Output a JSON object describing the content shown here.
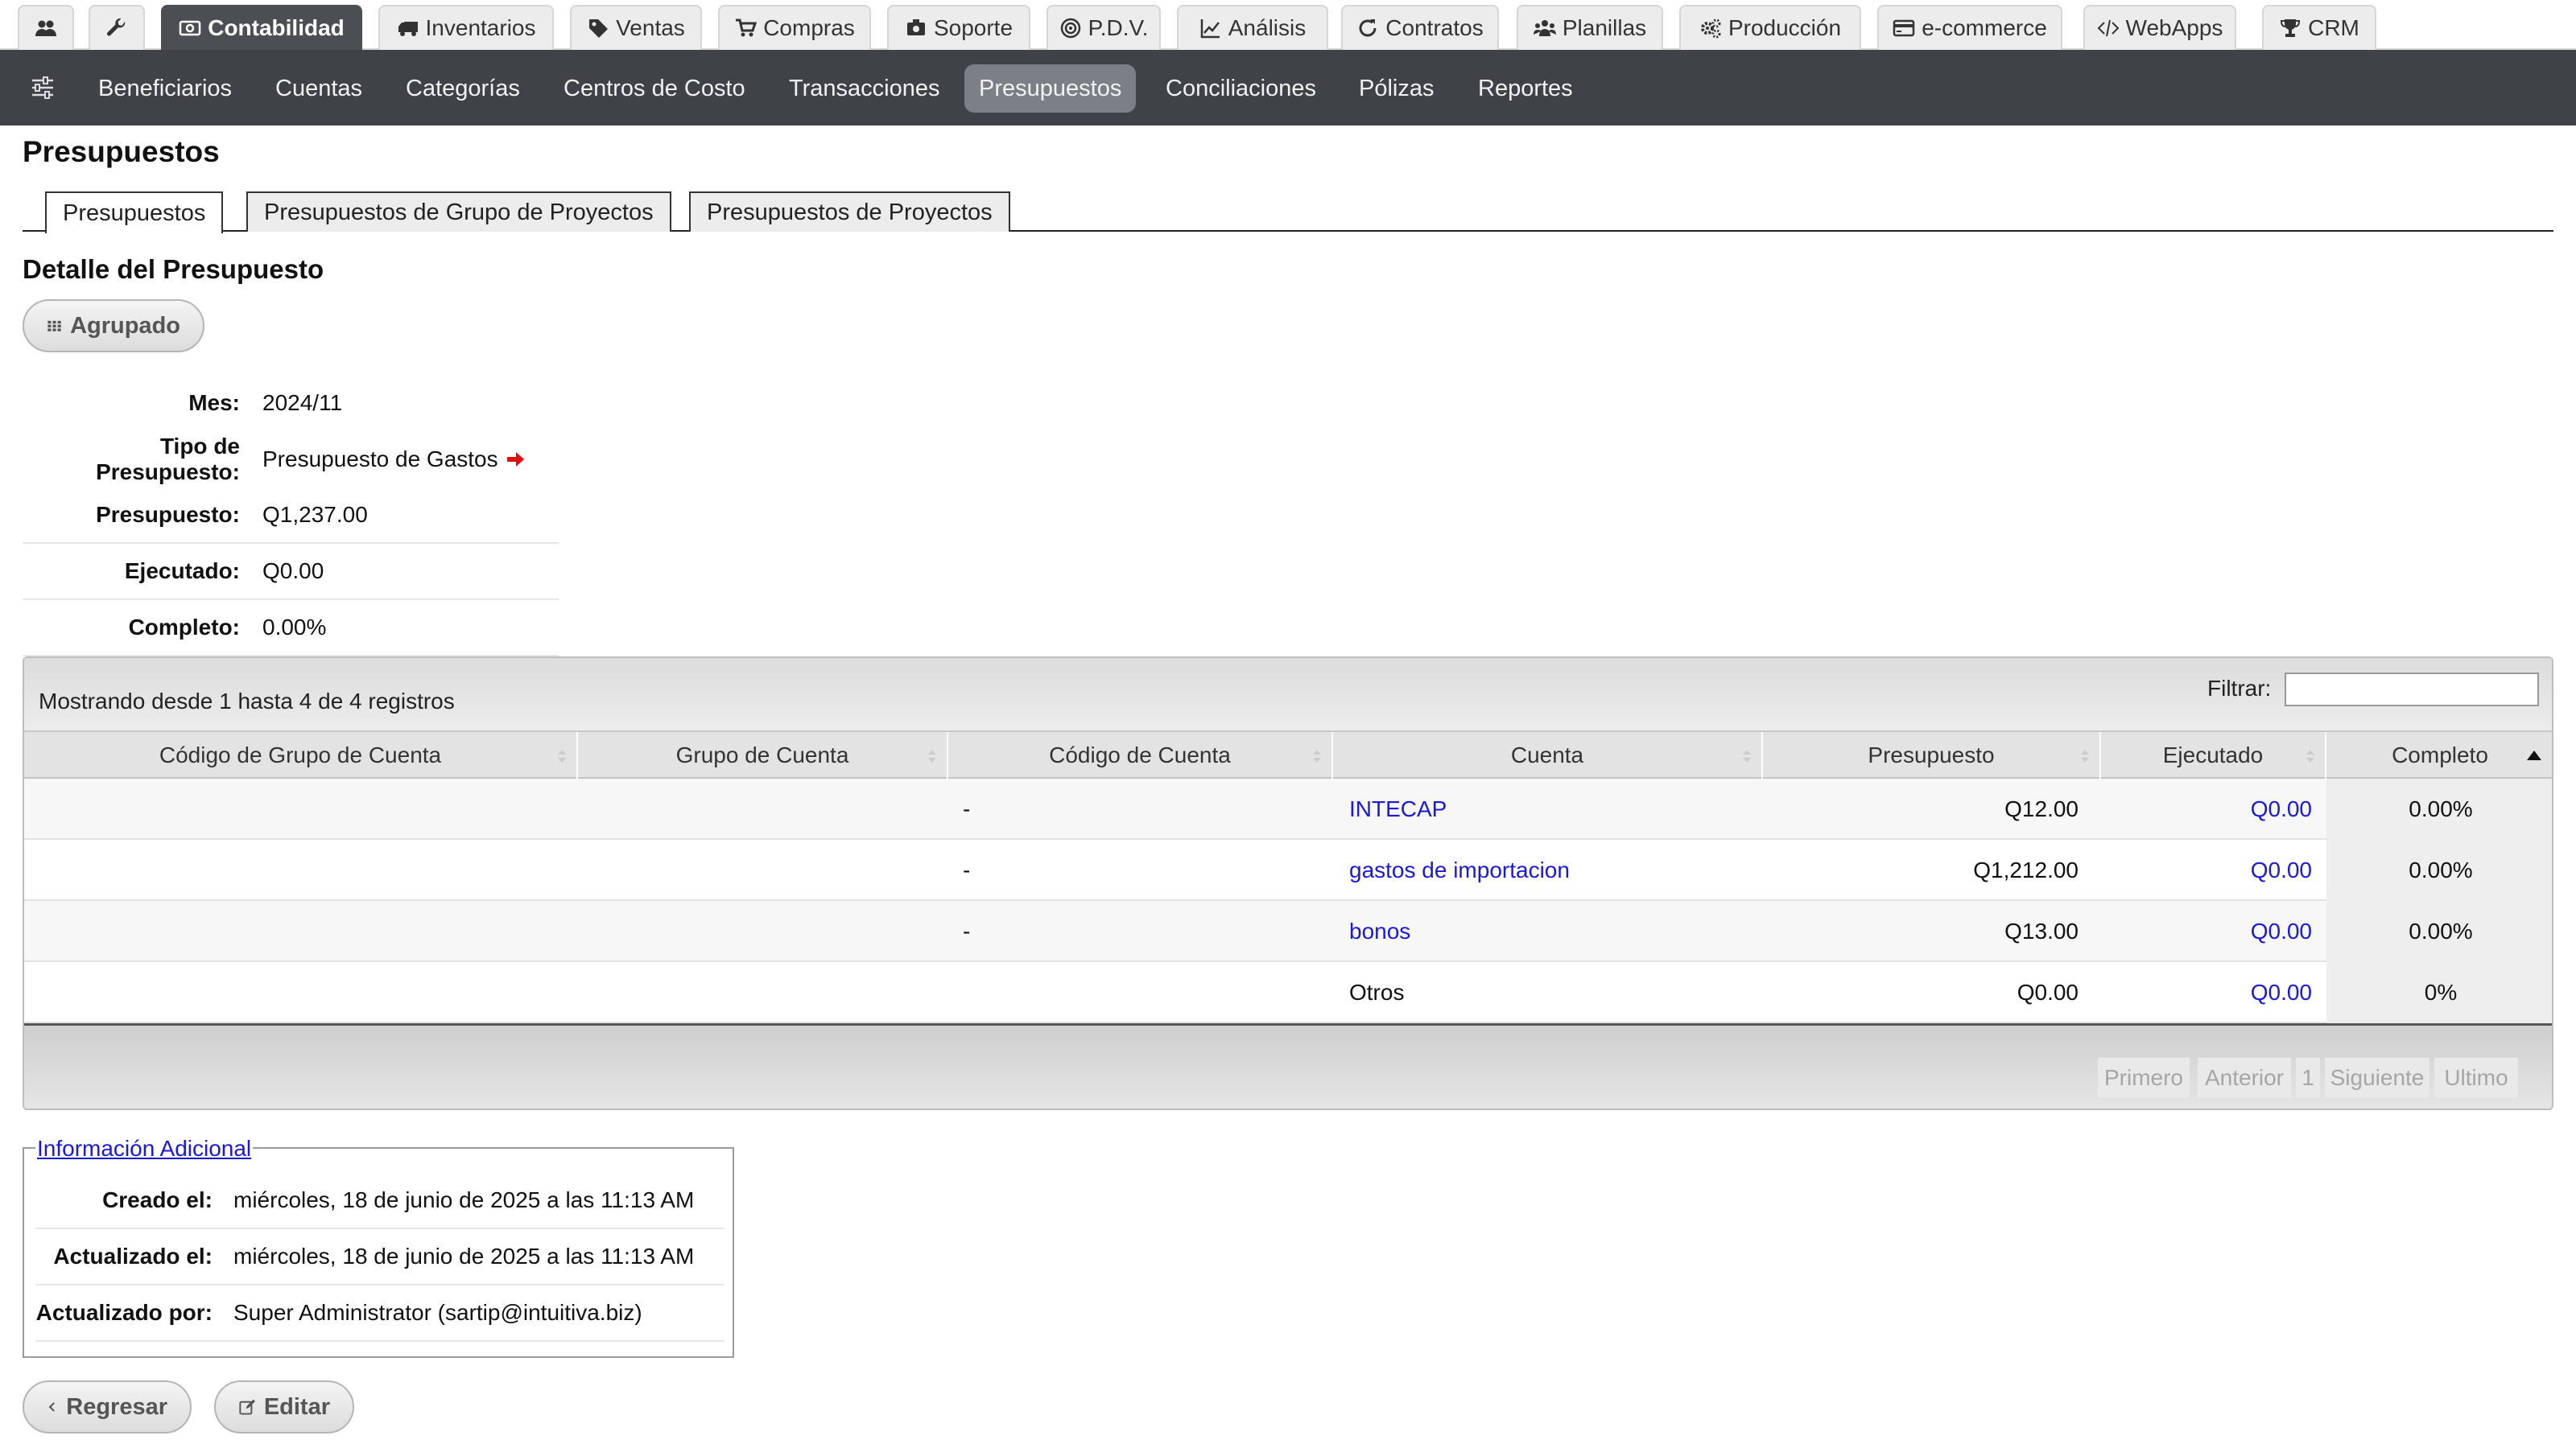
{
  "modules": [
    {
      "label": "",
      "icon": "users-icon"
    },
    {
      "label": "",
      "icon": "wrench-icon"
    },
    {
      "label": "Contabilidad",
      "icon": "money-icon"
    },
    {
      "label": "Inventarios",
      "icon": "truck-icon"
    },
    {
      "label": "Ventas",
      "icon": "tag-icon"
    },
    {
      "label": "Compras",
      "icon": "cart-icon"
    },
    {
      "label": "Soporte",
      "icon": "support-icon"
    },
    {
      "label": "P.D.V.",
      "icon": "pos-icon"
    },
    {
      "label": "Análisis",
      "icon": "chart-icon"
    },
    {
      "label": "Contratos",
      "icon": "refresh-icon"
    },
    {
      "label": "Planillas",
      "icon": "group-icon"
    },
    {
      "label": "Producción",
      "icon": "cogs-icon"
    },
    {
      "label": "e-commerce",
      "icon": "credit-card-icon"
    },
    {
      "label": "WebApps",
      "icon": "code-icon"
    },
    {
      "label": "CRM",
      "icon": "trophy-icon"
    }
  ],
  "subnav": [
    "Beneficiarios",
    "Cuentas",
    "Categorías",
    "Centros de Costo",
    "Transacciones",
    "Presupuestos",
    "Conciliaciones",
    "Pólizas",
    "Reportes"
  ],
  "page_title": "Presupuestos",
  "tabs": [
    "Presupuestos",
    "Presupuestos de Grupo de Proyectos",
    "Presupuestos de Proyectos"
  ],
  "section_title": "Detalle del Presupuesto",
  "grouped_button": "Agrupado",
  "details": {
    "mes_label": "Mes:",
    "mes": "2024/11",
    "tipo_label": "Tipo de Presupuesto:",
    "tipo": "Presupuesto de Gastos",
    "presupuesto_label": "Presupuesto:",
    "presupuesto": "Q1,237.00",
    "ejecutado_label": "Ejecutado:",
    "ejecutado": "Q0.00",
    "completo_label": "Completo:",
    "completo": "0.00%"
  },
  "table": {
    "info": "Mostrando desde 1 hasta 4 de 4 registros",
    "filter_label": "Filtrar:",
    "filter_value": "",
    "columns": [
      "Código de Grupo de Cuenta",
      "Grupo de Cuenta",
      "Código de Cuenta",
      "Cuenta",
      "Presupuesto",
      "Ejecutado",
      "Completo"
    ],
    "rows": [
      {
        "codigo_grupo": "",
        "grupo": "",
        "codigo": "-",
        "cuenta": "INTECAP",
        "presupuesto": "Q12.00",
        "ejecutado": "Q0.00",
        "completo": "0.00%"
      },
      {
        "codigo_grupo": "",
        "grupo": "",
        "codigo": "-",
        "cuenta": "gastos de importacion",
        "presupuesto": "Q1,212.00",
        "ejecutado": "Q0.00",
        "completo": "0.00%"
      },
      {
        "codigo_grupo": "",
        "grupo": "",
        "codigo": "-",
        "cuenta": "bonos",
        "presupuesto": "Q13.00",
        "ejecutado": "Q0.00",
        "completo": "0.00%"
      },
      {
        "codigo_grupo": "",
        "grupo": "",
        "codigo": "",
        "cuenta": "Otros",
        "presupuesto": "Q0.00",
        "ejecutado": "Q0.00",
        "completo": "0%"
      }
    ],
    "pagination": {
      "first": "Primero",
      "prev": "Anterior",
      "page": "1",
      "next": "Siguiente",
      "last": "Ultimo"
    }
  },
  "additional": {
    "title": "Información Adicional",
    "creado_label": "Creado el:",
    "creado": "miércoles, 18 de junio de 2025 a las 11:13 AM",
    "actualizado_label": "Actualizado el:",
    "actualizado": "miércoles, 18 de junio de 2025 a las 11:13 AM",
    "por_label": "Actualizado por:",
    "por": "Super Administrator (sartip@intuitiva.biz)"
  },
  "actions": {
    "back": "Regresar",
    "edit": "Editar"
  },
  "colors": {
    "link": "#1a1ad6",
    "nav_bg": "#3f4347",
    "active_tab": "#4b4f54",
    "arrow": "#e01010"
  }
}
